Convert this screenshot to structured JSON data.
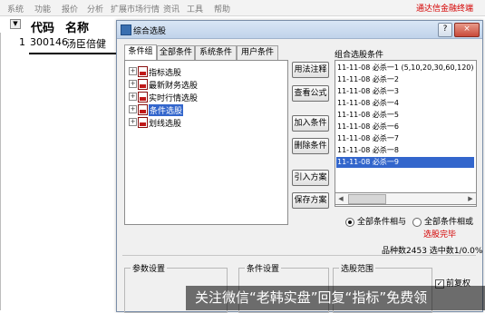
{
  "menubar": {
    "items": [
      "系统",
      "功能",
      "报价",
      "分析",
      "扩展市场行情",
      "资讯",
      "工具",
      "帮助"
    ],
    "brand": "通达信金融终端",
    "controls": [
      "-",
      "□",
      "×"
    ]
  },
  "stock_list": {
    "headers": {
      "sort": "▼",
      "code": "代码",
      "name": "名称"
    },
    "rows": [
      {
        "index": "1",
        "code": "300146",
        "name": "汤臣倍健"
      }
    ]
  },
  "dialog": {
    "title": "综合选股",
    "window_buttons": {
      "help": "?",
      "close": "×"
    },
    "tabs": [
      "条件组",
      "全部条件",
      "系统条件",
      "用户条件"
    ],
    "tree": [
      {
        "label": "指标选股",
        "toggle": "+"
      },
      {
        "label": "最新财务选股",
        "toggle": "+"
      },
      {
        "label": "实时行情选股",
        "toggle": "+"
      },
      {
        "label": "条件选股",
        "toggle": "+",
        "selected": true
      },
      {
        "label": "划线选股",
        "toggle": "+"
      }
    ],
    "buttons": [
      "用法注释",
      "查看公式",
      "加入条件",
      "删除条件",
      "引入方案",
      "保存方案"
    ],
    "conditions_label": "组合选股条件",
    "conditions": [
      "11-11-08 必杀一1  (5,10,20,30,60,120)",
      "11-11-08 必杀一2",
      "11-11-08 必杀一3",
      "11-11-08 必杀一4",
      "11-11-08 必杀一5",
      "11-11-08 必杀一6",
      "11-11-08 必杀一7",
      "11-11-08 必杀一8",
      "11-11-08 必杀一9"
    ],
    "selected_condition_index": 8,
    "radio": {
      "and_label": "全部条件相与",
      "or_label": "全部条件相或",
      "selected": "and"
    },
    "status_text": "选股完毕",
    "stats": {
      "total_label": "品种数",
      "total": "2453",
      "selected_label": "选中数",
      "selected": "1/0.0%"
    },
    "groups": [
      "参数设置",
      "条件设置",
      "选股范围"
    ],
    "checkbox": {
      "label": "前复权",
      "checked": true,
      "mark": "✓"
    }
  },
  "watermark": "关注微信“老韩实盘”回复“指标”免费领",
  "colors": {
    "selection": "#3366cc",
    "red": "#d40000",
    "dialog_bg": "#f0f0f0"
  }
}
